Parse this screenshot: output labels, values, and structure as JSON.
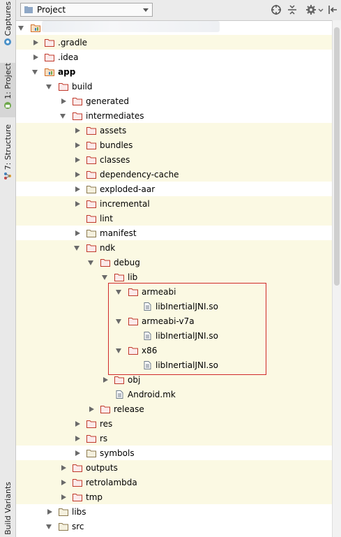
{
  "side_tabs": {
    "captures": "Captures",
    "project": "1: Project",
    "structure": "7: Structure",
    "build_variants": "Build Variants"
  },
  "header": {
    "view_label": "Project"
  },
  "colors": {
    "folder": "#c0392b",
    "module_folder": "#d3702b",
    "row_highlight": "#fbf9e3",
    "annotation_box": "#d02a2a"
  },
  "tree": [
    {
      "label": "",
      "depth": 0,
      "state": "down",
      "icon": "module-folder",
      "hl": false
    },
    {
      "label": ".gradle",
      "depth": 1,
      "state": "right",
      "icon": "folder",
      "hl": true
    },
    {
      "label": ".idea",
      "depth": 1,
      "state": "right",
      "icon": "folder",
      "hl": false
    },
    {
      "label": "app",
      "depth": 1,
      "state": "down",
      "icon": "module-folder",
      "hl": false,
      "bold": true
    },
    {
      "label": "build",
      "depth": 2,
      "state": "down",
      "icon": "folder",
      "hl": false
    },
    {
      "label": "generated",
      "depth": 3,
      "state": "right",
      "icon": "folder",
      "hl": false
    },
    {
      "label": "intermediates",
      "depth": 3,
      "state": "down",
      "icon": "folder",
      "hl": false
    },
    {
      "label": "assets",
      "depth": 4,
      "state": "right",
      "icon": "folder",
      "hl": true
    },
    {
      "label": "bundles",
      "depth": 4,
      "state": "right",
      "icon": "folder",
      "hl": true
    },
    {
      "label": "classes",
      "depth": 4,
      "state": "right",
      "icon": "folder",
      "hl": true
    },
    {
      "label": "dependency-cache",
      "depth": 4,
      "state": "right",
      "icon": "folder",
      "hl": true
    },
    {
      "label": "exploded-aar",
      "depth": 4,
      "state": "right",
      "icon": "folder-plain",
      "hl": false
    },
    {
      "label": "incremental",
      "depth": 4,
      "state": "right",
      "icon": "folder",
      "hl": true
    },
    {
      "label": "lint",
      "depth": 4,
      "state": "none",
      "icon": "folder",
      "hl": true
    },
    {
      "label": "manifest",
      "depth": 4,
      "state": "right",
      "icon": "folder-plain",
      "hl": false
    },
    {
      "label": "ndk",
      "depth": 4,
      "state": "down",
      "icon": "folder",
      "hl": true
    },
    {
      "label": "debug",
      "depth": 5,
      "state": "down",
      "icon": "folder",
      "hl": true
    },
    {
      "label": "lib",
      "depth": 6,
      "state": "down",
      "icon": "folder",
      "hl": true
    },
    {
      "label": "armeabi",
      "depth": 7,
      "state": "down",
      "icon": "folder",
      "hl": true
    },
    {
      "label": "libInertialJNI.so",
      "depth": 8,
      "state": "none",
      "icon": "file",
      "hl": true
    },
    {
      "label": "armeabi-v7a",
      "depth": 7,
      "state": "down",
      "icon": "folder",
      "hl": true
    },
    {
      "label": "libInertialJNI.so",
      "depth": 8,
      "state": "none",
      "icon": "file",
      "hl": true
    },
    {
      "label": "x86",
      "depth": 7,
      "state": "down",
      "icon": "folder",
      "hl": true
    },
    {
      "label": "libInertialJNI.so",
      "depth": 8,
      "state": "none",
      "icon": "file",
      "hl": true
    },
    {
      "label": "obj",
      "depth": 6,
      "state": "right",
      "icon": "folder",
      "hl": true
    },
    {
      "label": "Android.mk",
      "depth": 6,
      "state": "none",
      "icon": "file",
      "hl": true
    },
    {
      "label": "release",
      "depth": 5,
      "state": "right",
      "icon": "folder",
      "hl": true
    },
    {
      "label": "res",
      "depth": 4,
      "state": "right",
      "icon": "folder",
      "hl": true
    },
    {
      "label": "rs",
      "depth": 4,
      "state": "right",
      "icon": "folder",
      "hl": true
    },
    {
      "label": "symbols",
      "depth": 4,
      "state": "right",
      "icon": "folder-plain",
      "hl": false
    },
    {
      "label": "outputs",
      "depth": 3,
      "state": "right",
      "icon": "folder",
      "hl": true
    },
    {
      "label": "retrolambda",
      "depth": 3,
      "state": "right",
      "icon": "folder",
      "hl": true
    },
    {
      "label": "tmp",
      "depth": 3,
      "state": "right",
      "icon": "folder",
      "hl": true
    },
    {
      "label": "libs",
      "depth": 2,
      "state": "right",
      "icon": "folder-plain",
      "hl": false
    },
    {
      "label": "src",
      "depth": 2,
      "state": "down",
      "icon": "folder-plain",
      "hl": false
    }
  ]
}
